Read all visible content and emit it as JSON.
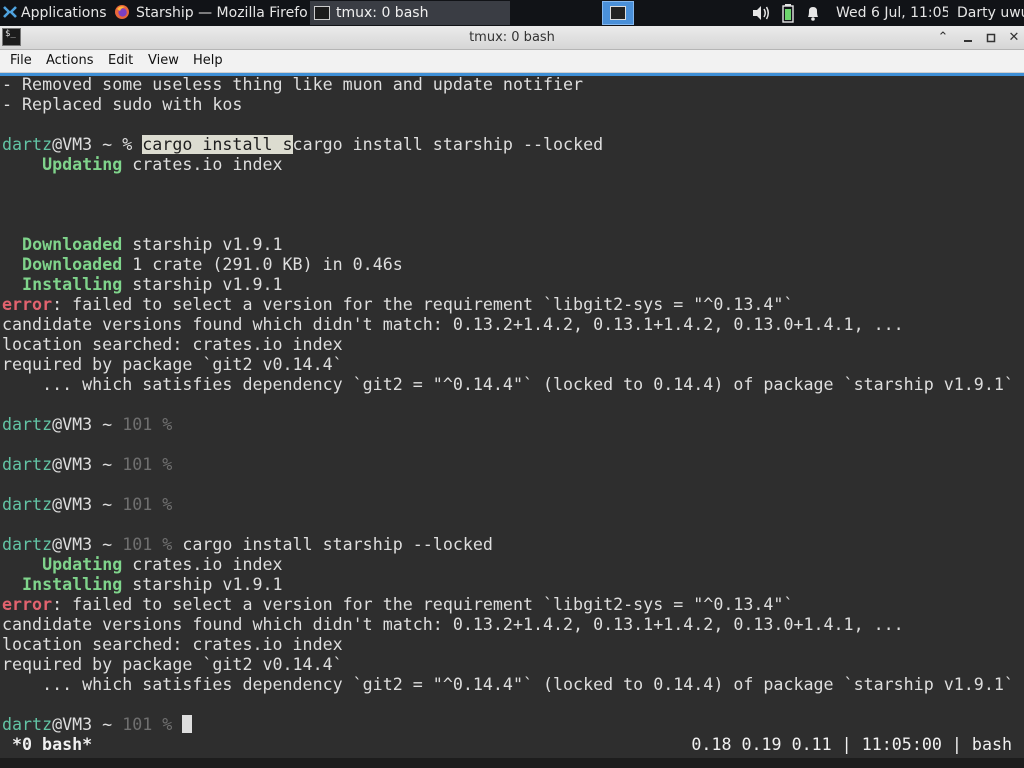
{
  "panel": {
    "applications": "Applications",
    "tasks": [
      {
        "title": "Starship — Mozilla Firefox",
        "icon": "firefox-icon",
        "active": false
      },
      {
        "title": "tmux: 0 bash",
        "icon": "terminal-icon",
        "active": true
      }
    ],
    "clock": "Wed  6 Jul, 11:05",
    "user": "Darty uwu"
  },
  "window": {
    "title": "tmux: 0 bash"
  },
  "menu": [
    "File",
    "Actions",
    "Edit",
    "View",
    "Help"
  ],
  "terminal": {
    "lines": [
      [
        {
          "t": "- Removed some useless thing like muon and update notifier"
        }
      ],
      [
        {
          "t": "- Replaced sudo with kos"
        }
      ],
      [],
      [
        {
          "t": "dartz",
          "c": "g"
        },
        {
          "t": "@VM3 ~ % "
        },
        {
          "t": "cargo install s",
          "c": "hl"
        },
        {
          "t": "cargo install starship --locked"
        }
      ],
      [
        {
          "t": "    "
        },
        {
          "t": "Updating",
          "c": "b"
        },
        {
          "t": " crates.io index"
        }
      ],
      [],
      [],
      [],
      [
        {
          "t": "  "
        },
        {
          "t": "Downloaded",
          "c": "b"
        },
        {
          "t": " starship v1.9.1"
        }
      ],
      [
        {
          "t": "  "
        },
        {
          "t": "Downloaded",
          "c": "b"
        },
        {
          "t": " 1 crate (291.0 KB) in 0.46s"
        }
      ],
      [
        {
          "t": "  "
        },
        {
          "t": "Installing",
          "c": "b"
        },
        {
          "t": " starship v1.9.1"
        }
      ],
      [
        {
          "t": "error",
          "c": "r"
        },
        {
          "t": ": failed to select a version for the requirement `libgit2-sys = \"^0.13.4\"`"
        }
      ],
      [
        {
          "t": "candidate versions found which didn't match: 0.13.2+1.4.2, 0.13.1+1.4.2, 0.13.0+1.4.1, ..."
        }
      ],
      [
        {
          "t": "location searched: crates.io index"
        }
      ],
      [
        {
          "t": "required by package `git2 v0.14.4`"
        }
      ],
      [
        {
          "t": "    ... which satisfies dependency `git2 = \"^0.14.4\"` (locked to 0.14.4) of package `starship v1.9.1`"
        }
      ],
      [],
      [
        {
          "t": "dartz",
          "c": "g"
        },
        {
          "t": "@VM3 ~ "
        },
        {
          "t": "101 %",
          "c": "dim"
        }
      ],
      [],
      [
        {
          "t": "dartz",
          "c": "g"
        },
        {
          "t": "@VM3 ~ "
        },
        {
          "t": "101 %",
          "c": "dim"
        }
      ],
      [],
      [
        {
          "t": "dartz",
          "c": "g"
        },
        {
          "t": "@VM3 ~ "
        },
        {
          "t": "101 %",
          "c": "dim"
        }
      ],
      [],
      [
        {
          "t": "dartz",
          "c": "g"
        },
        {
          "t": "@VM3 ~ "
        },
        {
          "t": "101 %",
          "c": "dim"
        },
        {
          "t": " cargo install starship --locked"
        }
      ],
      [
        {
          "t": "    "
        },
        {
          "t": "Updating",
          "c": "b"
        },
        {
          "t": " crates.io index"
        }
      ],
      [
        {
          "t": "  "
        },
        {
          "t": "Installing",
          "c": "b"
        },
        {
          "t": " starship v1.9.1"
        }
      ],
      [
        {
          "t": "error",
          "c": "r"
        },
        {
          "t": ": failed to select a version for the requirement `libgit2-sys = \"^0.13.4\"`"
        }
      ],
      [
        {
          "t": "candidate versions found which didn't match: 0.13.2+1.4.2, 0.13.1+1.4.2, 0.13.0+1.4.1, ..."
        }
      ],
      [
        {
          "t": "location searched: crates.io index"
        }
      ],
      [
        {
          "t": "required by package `git2 v0.14.4`"
        }
      ],
      [
        {
          "t": "    ... which satisfies dependency `git2 = \"^0.14.4\"` (locked to 0.14.4) of package `starship v1.9.1`"
        }
      ],
      [],
      [
        {
          "t": "dartz",
          "c": "g"
        },
        {
          "t": "@VM3 ~ "
        },
        {
          "t": "101 %",
          "c": "dim"
        },
        {
          "t": " "
        },
        {
          "cursor": true
        }
      ]
    ]
  },
  "status": {
    "left": "*0 bash*",
    "right": "0.18 0.19 0.11 | 11:05:00 | bash"
  },
  "colors": {
    "user": "#62c4a4",
    "cargo_status": "#7fd48b",
    "error": "#e2626e",
    "accent": "#3e8fd6"
  }
}
